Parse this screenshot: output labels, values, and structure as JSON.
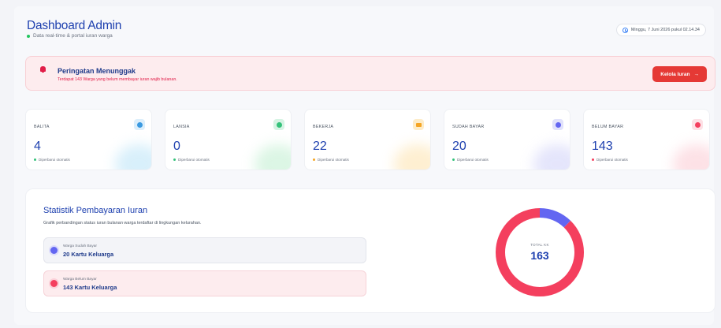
{
  "header": {
    "title": "Dashboard Admin",
    "subtitle": "Data real-time & portal iuran warga",
    "date": "Minggu, 7 Juni 2026 pukul 02.14.34"
  },
  "alert": {
    "title": "Peringatan Menunggak",
    "text": "Terdapat 143 Warga yang belum membayar iuran wajib bulanan.",
    "button_label": "Kelola Iuran",
    "button_arrow": "→"
  },
  "stats": [
    {
      "label": "BALITA",
      "value": "4",
      "note": "Diperbarui otomatis",
      "icon": "baby-icon",
      "color": "#3b9ae1"
    },
    {
      "label": "LANSIA",
      "value": "0",
      "note": "Diperbarui otomatis",
      "icon": "user-icon",
      "color": "#34c27a"
    },
    {
      "label": "BEKERJA",
      "value": "22",
      "note": "Diperbarui otomatis",
      "icon": "briefcase-icon",
      "color": "#f5a524"
    },
    {
      "label": "SUDAH BAYAR",
      "value": "20",
      "note": "Diperbarui otomatis",
      "icon": "check-icon",
      "color": "#6366f1"
    },
    {
      "label": "BELUM BAYAR",
      "value": "143",
      "note": "Diperbarui otomatis",
      "icon": "close-icon",
      "color": "#f43f5e"
    }
  ],
  "panel": {
    "title": "Statistik Pembayaran Iuran",
    "subtitle": "Grafik perbandingan status iuran bulanan warga terdaftar di lingkungan kelurahan.",
    "paid_label": "Warga Sudah Bayar",
    "paid_value": "20 Kartu Keluarga",
    "unpaid_label": "Warga Belum Bayar",
    "unpaid_value": "143 Kartu Keluarga",
    "total_label": "TOTAL KK",
    "total_value": "163"
  },
  "chart_data": {
    "type": "pie",
    "categories": [
      "Warga Sudah Bayar",
      "Warga Belum Bayar"
    ],
    "values": [
      20,
      143
    ],
    "colors": [
      "#6366f1",
      "#f43f5e"
    ]
  }
}
